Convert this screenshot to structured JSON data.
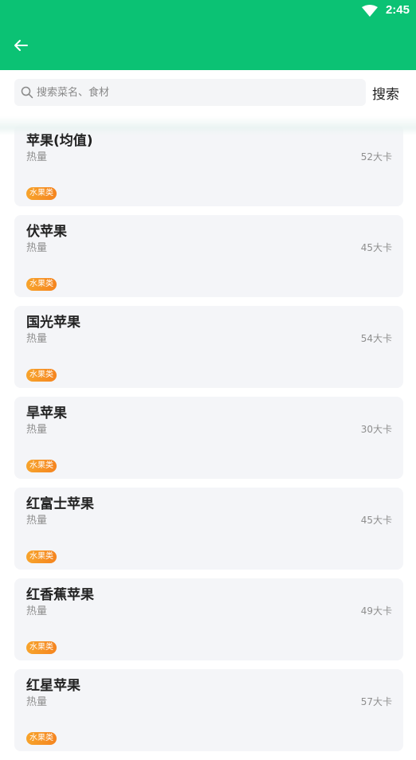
{
  "status_bar": {
    "time": "2:45"
  },
  "search": {
    "placeholder": "搜索菜名、食材",
    "value": "",
    "button_label": "搜索"
  },
  "results": [
    {
      "name": "苹果(均值)",
      "kcal_label": "热量",
      "kcal_value": "52大卡",
      "tag": "水果类"
    },
    {
      "name": "伏苹果",
      "kcal_label": "热量",
      "kcal_value": "45大卡",
      "tag": "水果类"
    },
    {
      "name": "国光苹果",
      "kcal_label": "热量",
      "kcal_value": "54大卡",
      "tag": "水果类"
    },
    {
      "name": "旱苹果",
      "kcal_label": "热量",
      "kcal_value": "30大卡",
      "tag": "水果类"
    },
    {
      "name": "红富士苹果",
      "kcal_label": "热量",
      "kcal_value": "45大卡",
      "tag": "水果类"
    },
    {
      "name": "红香蕉苹果",
      "kcal_label": "热量",
      "kcal_value": "49大卡",
      "tag": "水果类"
    },
    {
      "name": "红星苹果",
      "kcal_label": "热量",
      "kcal_value": "57大卡",
      "tag": "水果类"
    }
  ],
  "colors": {
    "header": "#0bc274",
    "card": "#f4f5f8",
    "tag": "#f5901f"
  },
  "icons": {
    "back": "arrow-left-icon",
    "search": "magnifier-icon",
    "wifi": "wifi-icon"
  }
}
